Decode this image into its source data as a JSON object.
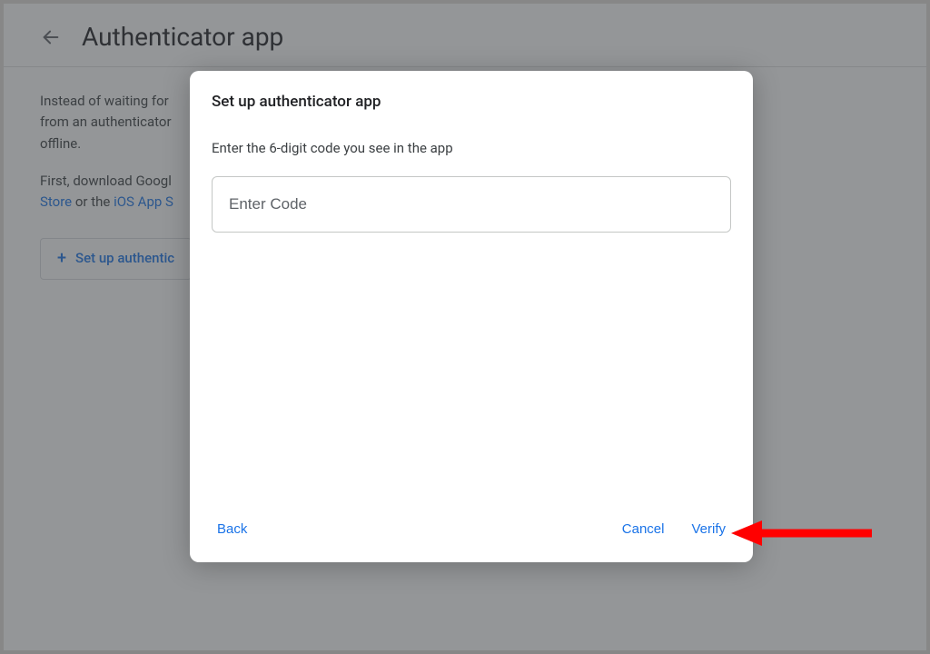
{
  "header": {
    "title": "Authenticator app"
  },
  "background": {
    "para1a": "Instead of waiting for ",
    "para1b": "from an authenticator",
    "para1c": "offline.",
    "para2a": "First, download Googl",
    "link_store": "Store",
    "para2_or": " or the ",
    "link_ios": "iOS App S",
    "setup_button": "Set up authentic"
  },
  "dialog": {
    "title": "Set up authenticator app",
    "instruction": "Enter the 6-digit code you see in the app",
    "input_placeholder": "Enter Code",
    "input_value": "",
    "back": "Back",
    "cancel": "Cancel",
    "verify": "Verify"
  }
}
